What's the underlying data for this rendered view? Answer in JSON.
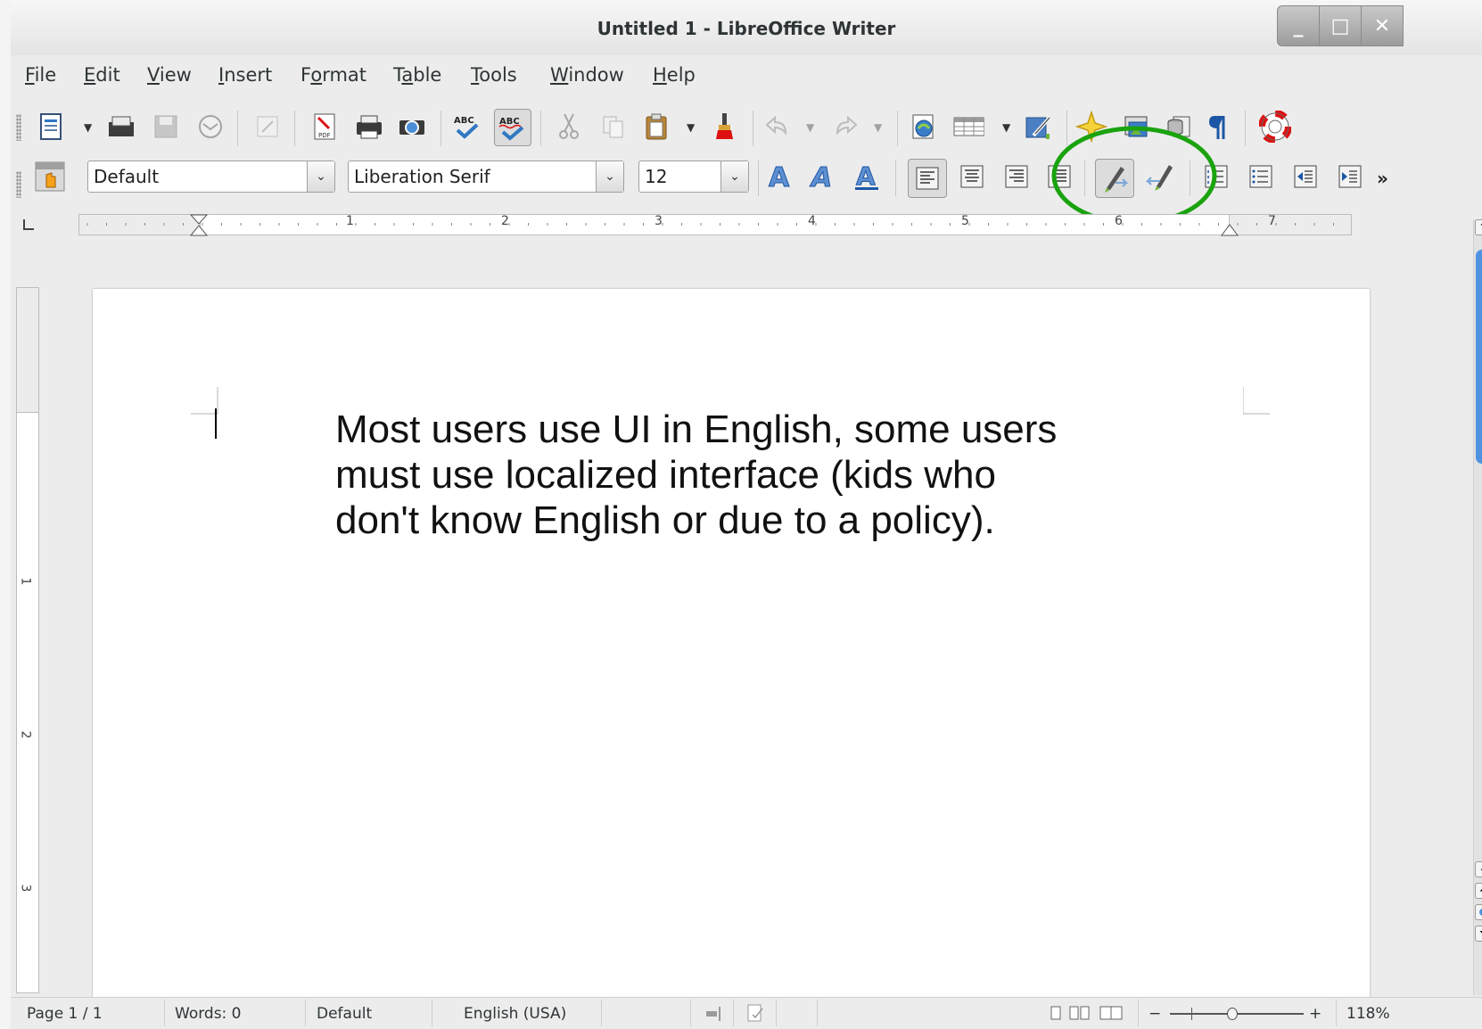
{
  "window": {
    "title": "Untitled 1 - LibreOffice Writer"
  },
  "titlebar_controls": {
    "minimize": "_",
    "maximize": "□",
    "close": "✕"
  },
  "menubar": [
    {
      "pre": "",
      "key": "F",
      "post": "ile"
    },
    {
      "pre": "",
      "key": "E",
      "post": "dit"
    },
    {
      "pre": "",
      "key": "V",
      "post": "iew"
    },
    {
      "pre": "",
      "key": "I",
      "post": "nsert"
    },
    {
      "pre": "F",
      "key": "o",
      "post": "rmat"
    },
    {
      "pre": "T",
      "key": "a",
      "post": "ble"
    },
    {
      "pre": "",
      "key": "T",
      "post": "ools"
    },
    {
      "pre": "",
      "key": "W",
      "post": "indow"
    },
    {
      "pre": "",
      "key": "H",
      "post": "elp"
    }
  ],
  "formatting": {
    "paragraph_style": "Default",
    "font_name": "Liberation Serif",
    "font_size": "12",
    "overflow": "»"
  },
  "ruler_labels": [
    "1",
    "2",
    "3",
    "4",
    "5",
    "6",
    "7"
  ],
  "vruler_labels": [
    "1",
    "2",
    "3"
  ],
  "document": {
    "lines": [
      "Most users use UI in English, some users",
      "must use localized interface (kids who",
      "don't know English or due to a policy)."
    ]
  },
  "status": {
    "page": "Page 1 / 1",
    "words": "Words: 0",
    "page_style": "Default",
    "language": "English (USA)",
    "zoom": "118%",
    "zoom_minus": "−",
    "zoom_plus": "+"
  },
  "highlight": {
    "color": "#1aa30e"
  },
  "icons": {
    "standard": [
      "new-document-icon",
      "open-icon",
      "save-icon",
      "email-icon",
      "edit-file-icon",
      "export-pdf-icon",
      "print-icon",
      "print-preview-icon",
      "spellcheck-icon",
      "autospellcheck-icon",
      "cut-icon",
      "copy-icon",
      "paste-icon",
      "clone-formatting-icon",
      "undo-icon",
      "redo-icon",
      "navigator-icon",
      "table-icon",
      "draw-functions-icon",
      "gallery-icon",
      "image-icon",
      "data-sources-icon",
      "formatting-marks-icon",
      "help-icon"
    ],
    "formatting": [
      "styles-icon",
      "bold-icon",
      "italic-icon",
      "underline-icon",
      "align-left-icon",
      "align-center-icon",
      "align-right-icon",
      "justify-icon",
      "left-to-right-icon",
      "right-to-left-icon",
      "numbering-icon",
      "bullets-icon",
      "decrease-indent-icon",
      "increase-indent-icon"
    ]
  }
}
